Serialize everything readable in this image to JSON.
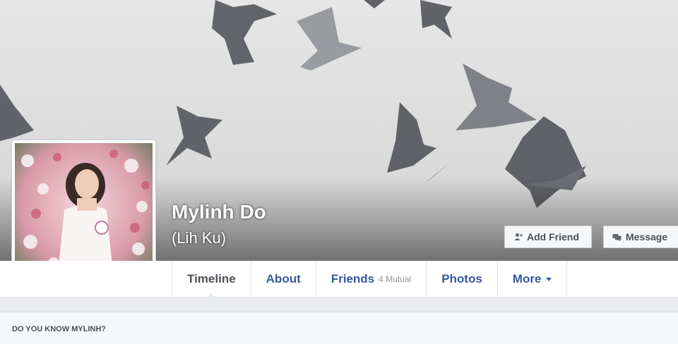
{
  "profile": {
    "name": "Mylinh Do",
    "alternate_name": "(Lih Ku)"
  },
  "actions": {
    "add_friend_label": "Add Friend",
    "message_label": "Message"
  },
  "tabs": [
    {
      "label": "Timeline",
      "active": true
    },
    {
      "label": "About"
    },
    {
      "label": "Friends",
      "count": "4 Mutual"
    },
    {
      "label": "Photos"
    },
    {
      "label": "More"
    }
  ],
  "suggestion_card": {
    "title": "DO YOU KNOW MYLINH?"
  },
  "colors": {
    "link": "#365899",
    "page_background": "#e9ebee",
    "button_background": "#f6f7f9"
  }
}
